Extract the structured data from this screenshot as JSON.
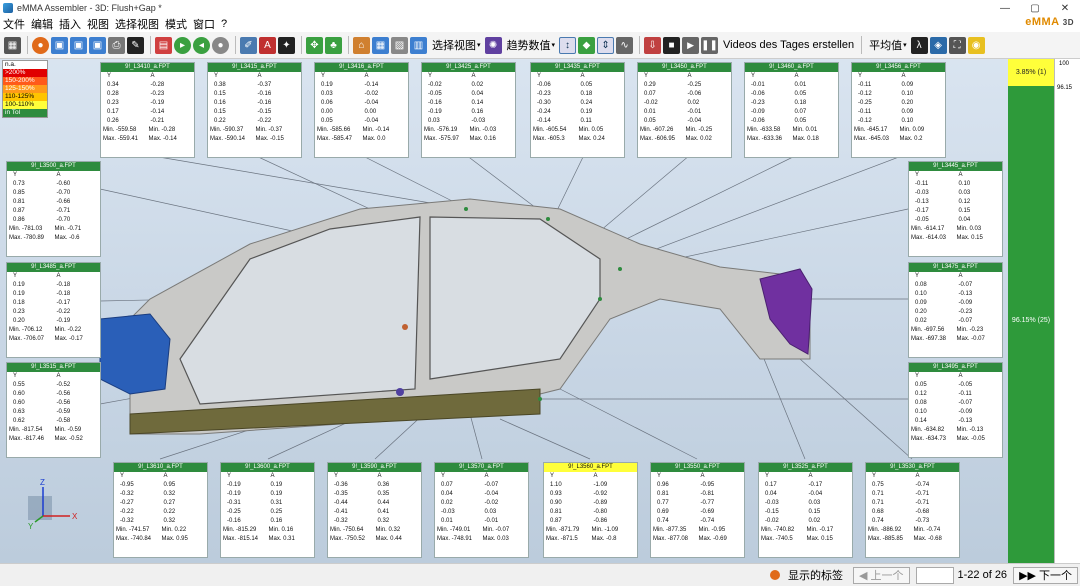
{
  "window": {
    "title": "eMMA Assembler - 3D: Flush+Gap *",
    "logo": "eMMA",
    "logo_suffix": "3D"
  },
  "menu": [
    "文件",
    "编辑",
    "插入",
    "视图",
    "选择视图",
    "模式",
    "窗口",
    "?"
  ],
  "toolbar": {
    "select_view": "选择视图",
    "trend": "趋势数值",
    "video": "Videos des Tages erstellen",
    "average": "平均值"
  },
  "legend": [
    {
      "label": "n.a.",
      "color": "#ffffff"
    },
    {
      "label": ">200%",
      "color": "#e00000"
    },
    {
      "label": "150-200%",
      "color": "#ff5a1a"
    },
    {
      "label": "125-150%",
      "color": "#ff9a1a"
    },
    {
      "label": "110-125%",
      "color": "#ffc400"
    },
    {
      "label": "100-110%",
      "color": "#ffff3a"
    },
    {
      "label": "in Tol",
      "color": "#2e8b3e"
    }
  ],
  "cards": [
    {
      "name": "9!_L3410_a.FPT",
      "rows": [
        [
          "0.34",
          "-0.28"
        ],
        [
          "0.28",
          "-0.23"
        ],
        [
          "0.23",
          "-0.19"
        ],
        [
          "0.17",
          "-0.14"
        ],
        [
          "0.26",
          "-0.21"
        ]
      ],
      "min": [
        "Min. -559.58",
        "Min. -0.28"
      ],
      "max": [
        "Max. -559.41",
        "Max. -0.14"
      ]
    },
    {
      "name": "9!_L3415_a.FPT",
      "rows": [
        [
          "0.38",
          "-0.37"
        ],
        [
          "0.15",
          "-0.16"
        ],
        [
          "0.16",
          "-0.16"
        ],
        [
          "0.15",
          "-0.15"
        ],
        [
          "0.22",
          "-0.22"
        ]
      ],
      "min": [
        "Min. -590.37",
        "Min. -0.37"
      ],
      "max": [
        "Max. -590.14",
        "Max. -0.15"
      ]
    },
    {
      "name": "9!_L3416_a.FPT",
      "rows": [
        [
          "0.19",
          "-0.14"
        ],
        [
          "0.03",
          "-0.02"
        ],
        [
          "0.06",
          "-0.04"
        ],
        [
          "0.00",
          "0.00"
        ],
        [
          "0.05",
          "-0.04"
        ]
      ],
      "min": [
        "Min. -585.66",
        "Min. -0.14"
      ],
      "max": [
        "Max. -585.47",
        "Max. 0.0"
      ]
    },
    {
      "name": "9!_L3425_a.FPT",
      "rows": [
        [
          "-0.02",
          "0.02"
        ],
        [
          "-0.05",
          "0.04"
        ],
        [
          "-0.16",
          "0.14"
        ],
        [
          "-0.19",
          "0.16"
        ],
        [
          "0.03",
          "-0.03"
        ]
      ],
      "min": [
        "Min. -576.19",
        "Min. -0.03"
      ],
      "max": [
        "Max. -575.97",
        "Max. 0.16"
      ]
    },
    {
      "name": "9!_L3435_a.FPT",
      "rows": [
        [
          "-0.06",
          "0.05"
        ],
        [
          "-0.23",
          "0.18"
        ],
        [
          "-0.30",
          "0.24"
        ],
        [
          "-0.24",
          "0.19"
        ],
        [
          "-0.14",
          "0.11"
        ]
      ],
      "min": [
        "Min. -605.54",
        "Min. 0.05"
      ],
      "max": [
        "Max. -605.3",
        "Max. 0.24"
      ]
    },
    {
      "name": "9!_L3450_a.FPT",
      "rows": [
        [
          "0.29",
          "-0.25"
        ],
        [
          "0.07",
          "-0.06"
        ],
        [
          "-0.02",
          "0.02"
        ],
        [
          "0.01",
          "-0.01"
        ],
        [
          "0.05",
          "-0.04"
        ]
      ],
      "min": [
        "Min. -607.26",
        "Min. -0.25"
      ],
      "max": [
        "Max. -606.95",
        "Max. 0.02"
      ]
    },
    {
      "name": "9!_L3460_a.FPT",
      "rows": [
        [
          "-0.01",
          "0.01"
        ],
        [
          "-0.06",
          "0.05"
        ],
        [
          "-0.23",
          "0.18"
        ],
        [
          "-0.09",
          "0.07"
        ],
        [
          "-0.06",
          "0.05"
        ]
      ],
      "min": [
        "Min. -633.58",
        "Min. 0.01"
      ],
      "max": [
        "Max. -633.36",
        "Max. 0.18"
      ]
    },
    {
      "name": "9!_L3456_a.FPT",
      "rows": [
        [
          "-0.11",
          "0.09"
        ],
        [
          "-0.12",
          "0.10"
        ],
        [
          "-0.25",
          "0.20"
        ],
        [
          "-0.11",
          "0.09"
        ],
        [
          "-0.12",
          "0.10"
        ]
      ],
      "min": [
        "Min. -645.17",
        "Min. 0.09"
      ],
      "max": [
        "Max. -645.03",
        "Max. 0.2"
      ]
    },
    {
      "name": "9!_L3500_a.FPT",
      "rows": [
        [
          "0.73",
          "-0.60"
        ],
        [
          "0.85",
          "-0.70"
        ],
        [
          "0.81",
          "-0.66"
        ],
        [
          "0.87",
          "-0.71"
        ],
        [
          "0.86",
          "-0.70"
        ]
      ],
      "min": [
        "Min. -781.03",
        "Min. -0.71"
      ],
      "max": [
        "Max. -780.89",
        "Max. -0.6"
      ]
    },
    {
      "name": "9!_L3445_a.FPT",
      "rows": [
        [
          "-0.11",
          "0.10"
        ],
        [
          "-0.03",
          "0.03"
        ],
        [
          "-0.13",
          "0.12"
        ],
        [
          "-0.17",
          "0.15"
        ],
        [
          "-0.05",
          "0.04"
        ]
      ],
      "min": [
        "Min. -614.17",
        "Min. 0.03"
      ],
      "max": [
        "Max. -614.03",
        "Max. 0.15"
      ]
    },
    {
      "name": "9!_L3485_a.FPT",
      "rows": [
        [
          "0.19",
          "-0.18"
        ],
        [
          "0.19",
          "-0.18"
        ],
        [
          "0.18",
          "-0.17"
        ],
        [
          "0.23",
          "-0.22"
        ],
        [
          "0.20",
          "-0.19"
        ]
      ],
      "min": [
        "Min. -706.12",
        "Min. -0.22"
      ],
      "max": [
        "Max. -706.07",
        "Max. -0.17"
      ]
    },
    {
      "name": "9!_L3475_a.FPT",
      "rows": [
        [
          "0.08",
          "-0.07"
        ],
        [
          "0.10",
          "-0.13"
        ],
        [
          "0.09",
          "-0.09"
        ],
        [
          "0.20",
          "-0.23"
        ],
        [
          "0.02",
          "-0.07"
        ]
      ],
      "min": [
        "Min. -697.56",
        "Min. -0.23"
      ],
      "max": [
        "Max. -697.38",
        "Max. -0.07"
      ]
    },
    {
      "name": "9!_L3515_a.FPT",
      "rows": [
        [
          "0.55",
          "-0.52"
        ],
        [
          "0.60",
          "-0.56"
        ],
        [
          "0.60",
          "-0.56"
        ],
        [
          "0.63",
          "-0.59"
        ],
        [
          "0.62",
          "-0.58"
        ]
      ],
      "min": [
        "Min. -817.54",
        "Min. -0.59"
      ],
      "max": [
        "Max. -817.46",
        "Max. -0.52"
      ]
    },
    {
      "name": "9!_L3495_a.FPT",
      "rows": [
        [
          "0.05",
          "-0.05"
        ],
        [
          "0.12",
          "-0.11"
        ],
        [
          "0.08",
          "-0.07"
        ],
        [
          "0.10",
          "-0.09"
        ],
        [
          "0.14",
          "-0.13"
        ]
      ],
      "min": [
        "Min. -634.82",
        "Min. -0.13"
      ],
      "max": [
        "Max. -634.73",
        "Max. -0.05"
      ]
    },
    {
      "name": "9!_L3610_a.FPT",
      "rows": [
        [
          "-0.95",
          "0.95"
        ],
        [
          "-0.32",
          "0.32"
        ],
        [
          "-0.27",
          "0.27"
        ],
        [
          "-0.22",
          "0.22"
        ],
        [
          "-0.32",
          "0.32"
        ]
      ],
      "min": [
        "Min. -741.57",
        "Min. 0.22"
      ],
      "max": [
        "Max. -740.84",
        "Max. 0.95"
      ]
    },
    {
      "name": "9!_L3600_a.FPT",
      "rows": [
        [
          "-0.19",
          "0.19"
        ],
        [
          "-0.19",
          "0.19"
        ],
        [
          "-0.31",
          "0.31"
        ],
        [
          "-0.25",
          "0.25"
        ],
        [
          "-0.16",
          "0.16"
        ]
      ],
      "min": [
        "Min. -815.29",
        "Min. 0.16"
      ],
      "max": [
        "Max. -815.14",
        "Max. 0.31"
      ]
    },
    {
      "name": "9!_L3590_a.FPT",
      "rows": [
        [
          "-0.36",
          "0.36"
        ],
        [
          "-0.35",
          "0.35"
        ],
        [
          "-0.44",
          "0.44"
        ],
        [
          "-0.41",
          "0.41"
        ],
        [
          "-0.32",
          "0.32"
        ]
      ],
      "min": [
        "Min. -750.64",
        "Min. 0.32"
      ],
      "max": [
        "Max. -750.52",
        "Max. 0.44"
      ]
    },
    {
      "name": "9!_L3570_a.FPT",
      "rows": [
        [
          "0.07",
          "-0.07"
        ],
        [
          "0.04",
          "-0.04"
        ],
        [
          "0.02",
          "-0.02"
        ],
        [
          "-0.03",
          "0.03"
        ],
        [
          "0.01",
          "-0.01"
        ]
      ],
      "min": [
        "Min. -749.01",
        "Min. -0.07"
      ],
      "max": [
        "Max. -748.91",
        "Max. 0.03"
      ]
    },
    {
      "name": "9!_L3560_a.FPT",
      "rows": [
        [
          "1.10",
          "-1.09"
        ],
        [
          "0.93",
          "-0.92"
        ],
        [
          "0.90",
          "-0.89"
        ],
        [
          "0.81",
          "-0.80"
        ],
        [
          "0.87",
          "-0.86"
        ]
      ],
      "min": [
        "Min. -871.79",
        "Min. -1.09"
      ],
      "max": [
        "Max. -871.5",
        "Max. -0.8"
      ]
    },
    {
      "name": "9!_L3550_a.FPT",
      "rows": [
        [
          "0.96",
          "-0.95"
        ],
        [
          "0.81",
          "-0.81"
        ],
        [
          "0.77",
          "-0.77"
        ],
        [
          "0.69",
          "-0.69"
        ],
        [
          "0.74",
          "-0.74"
        ]
      ],
      "min": [
        "Min. -877.35",
        "Min. -0.95"
      ],
      "max": [
        "Max. -877.08",
        "Max. -0.69"
      ]
    },
    {
      "name": "9!_L3525_a.FPT",
      "rows": [
        [
          "0.17",
          "-0.17"
        ],
        [
          "0.04",
          "-0.04"
        ],
        [
          "-0.03",
          "0.03"
        ],
        [
          "-0.15",
          "0.15"
        ],
        [
          "-0.02",
          "0.02"
        ]
      ],
      "min": [
        "Min. -740.82",
        "Min. -0.17"
      ],
      "max": [
        "Max. -740.5",
        "Max. 0.15"
      ]
    },
    {
      "name": "9!_L3530_a.FPT",
      "rows": [
        [
          "0.75",
          "-0.74"
        ],
        [
          "0.71",
          "-0.71"
        ],
        [
          "0.71",
          "-0.71"
        ],
        [
          "0.68",
          "-0.68"
        ],
        [
          "0.74",
          "-0.73"
        ]
      ],
      "min": [
        "Min. -886.92",
        "Min. -0.74"
      ],
      "max": [
        "Max. -885.85",
        "Max. -0.68"
      ]
    }
  ],
  "card_col_y": "Y",
  "card_col_a": "A",
  "status_panel": {
    "top": "3.85% (1)",
    "mid": "96.15% (25)",
    "scale_top": "100",
    "scale_mid": "96.15"
  },
  "statusbar": {
    "show_labels": "显示的标签",
    "prev": "上一个",
    "page_input": "",
    "page_info": "1-22 of 26",
    "next": "下一个"
  },
  "axes": {
    "x": "X",
    "y": "Y",
    "z": "Z"
  }
}
